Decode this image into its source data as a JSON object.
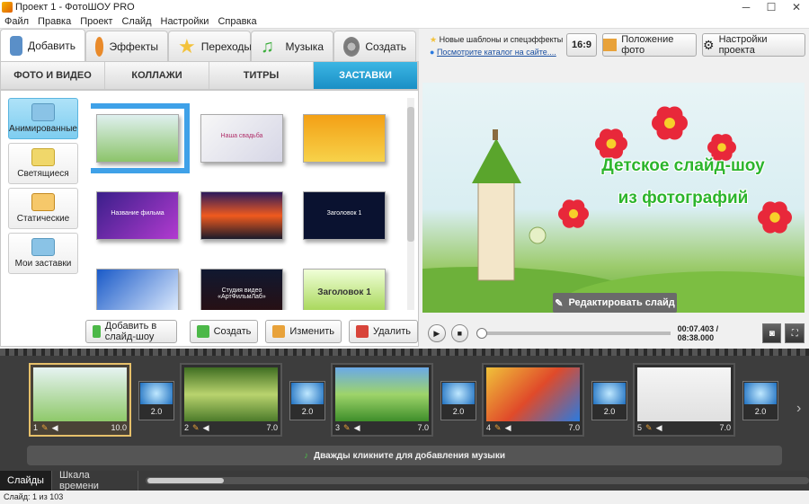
{
  "window": {
    "title": "Проект 1 - ФотоШОУ PRO",
    "minimize": "─",
    "maximize": "☐",
    "close": "✕"
  },
  "menu": [
    "Файл",
    "Правка",
    "Проект",
    "Слайд",
    "Настройки",
    "Справка"
  ],
  "main_tabs": [
    {
      "label": "Добавить",
      "icon": "camera-icon",
      "color": "#5a8fc8"
    },
    {
      "label": "Эффекты",
      "icon": "palette-icon",
      "color": "#e98a2a"
    },
    {
      "label": "Переходы",
      "icon": "star-icon",
      "color": "#f3c23b"
    },
    {
      "label": "Музыка",
      "icon": "music-note-icon",
      "color": "#3dae3d"
    },
    {
      "label": "Создать",
      "icon": "film-reel-icon",
      "color": "#8a8a8a"
    }
  ],
  "sub_tabs": [
    "ФОТО И ВИДЕО",
    "КОЛЛАЖИ",
    "ТИТРЫ",
    "ЗАСТАВКИ"
  ],
  "categories": [
    "Анимированные",
    "Светящиеся",
    "Статические",
    "Мои заставки"
  ],
  "gallery": {
    "items": [
      {
        "caption": "",
        "bg": "linear-gradient(#dff0ef,#8cc46a)",
        "selected": true
      },
      {
        "caption": "Наша свадьба",
        "bg": "linear-gradient(135deg,#f7f7f7,#d6d6e6)"
      },
      {
        "caption": "",
        "bg": "linear-gradient(#f3a015,#f7d24a)"
      },
      {
        "caption": "Название фильма",
        "bg": "linear-gradient(135deg,#3a1f8a,#b23bd0)"
      },
      {
        "caption": "",
        "bg": "linear-gradient(#2b1a5c,#f05a1e,#1a1a2a)"
      },
      {
        "caption": "Заголовок 1",
        "bg": "#0a1230"
      },
      {
        "caption": "",
        "bg": "linear-gradient(135deg,#1a5ac8,#e5f0ff)"
      },
      {
        "caption": "Студия видео «АртФильмЛаб»",
        "bg": "linear-gradient(#101830,#2a0f10)"
      },
      {
        "caption": "Заголовок 1",
        "bg": "linear-gradient(#f0ffd8,#9fd24a)"
      }
    ]
  },
  "actions": {
    "add": "Добавить в слайд-шоу",
    "create": "Создать",
    "edit": "Изменить",
    "delete": "Удалить"
  },
  "news": {
    "line1": "Новые шаблоны и спецэффекты",
    "link": "Посмотрите каталог на сайте...."
  },
  "right_buttons": {
    "ratio": "16:9",
    "position": "Положение фото",
    "settings": "Настройки проекта"
  },
  "preview": {
    "title_line1": "Детское слайд-шоу",
    "title_line2": "из фотографий",
    "edit_button": "Редактировать слайд"
  },
  "player": {
    "time": "00:07.403 / 08:38.000",
    "play": "▶",
    "stop": "■",
    "progress": 0.014
  },
  "slides": [
    {
      "num": "1",
      "dur": "10.0",
      "bg": "linear-gradient(#e6f3f2,#8fc96a)",
      "selected": true
    },
    {
      "num": "2",
      "dur": "7.0",
      "bg": "linear-gradient(#3f6e22,#b9d36e,#4c7b2a)"
    },
    {
      "num": "3",
      "dur": "7.0",
      "bg": "linear-gradient(#6aa9e8,#9ed46a,#3e8e2a)"
    },
    {
      "num": "4",
      "dur": "7.0",
      "bg": "linear-gradient(135deg,#f0c23a,#e04a2a,#2a7ae0)"
    },
    {
      "num": "5",
      "dur": "7.0",
      "bg": "linear-gradient(#f5f5f5,#e0e0e0)"
    }
  ],
  "transitions": [
    "2.0",
    "2.0",
    "2.0",
    "2.0",
    "2.0"
  ],
  "music_hint": "Дважды кликните для добавления музыки",
  "bottom_tabs": [
    "Слайды",
    "Шкала времени"
  ],
  "status": "Слайд: 1 из 103"
}
